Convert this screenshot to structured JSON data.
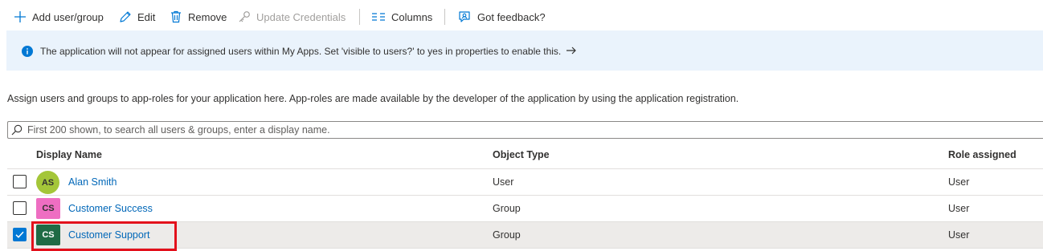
{
  "toolbar": {
    "add_label": "Add user/group",
    "edit_label": "Edit",
    "remove_label": "Remove",
    "update_label": "Update Credentials",
    "columns_label": "Columns",
    "feedback_label": "Got feedback?"
  },
  "banner": {
    "message": "The application will not appear for assigned users within My Apps. Set 'visible to users?' to yes in properties to enable this."
  },
  "description": "Assign users and groups to app-roles for your application here. App-roles are made available by the developer of the application by using the application registration.",
  "search": {
    "placeholder": "First 200 shown, to search all users & groups, enter a display name.",
    "value": ""
  },
  "grid": {
    "columns": {
      "display_name": "Display Name",
      "object_type": "Object Type",
      "role_assigned": "Role assigned"
    },
    "rows": [
      {
        "initials": "AS",
        "name": "Alan Smith",
        "type": "User",
        "role": "User",
        "checked": false,
        "avatar_color": "#a4c639",
        "avatar_text_color": "#323130",
        "avatar_shape": "round"
      },
      {
        "initials": "CS",
        "name": "Customer Success",
        "type": "Group",
        "role": "User",
        "checked": false,
        "avatar_color": "#ee6ec2",
        "avatar_text_color": "#323130",
        "avatar_shape": "square"
      },
      {
        "initials": "CS",
        "name": "Customer Support",
        "type": "Group",
        "role": "User",
        "checked": true,
        "avatar_color": "#1f6b45",
        "avatar_text_color": "#ffffff",
        "avatar_shape": "square"
      }
    ]
  },
  "colors": {
    "accent": "#0078d4",
    "link": "#0067b8",
    "banner_bg": "#eaf3fc",
    "highlight": "#e3101b",
    "selected_row": "#edebe9"
  }
}
